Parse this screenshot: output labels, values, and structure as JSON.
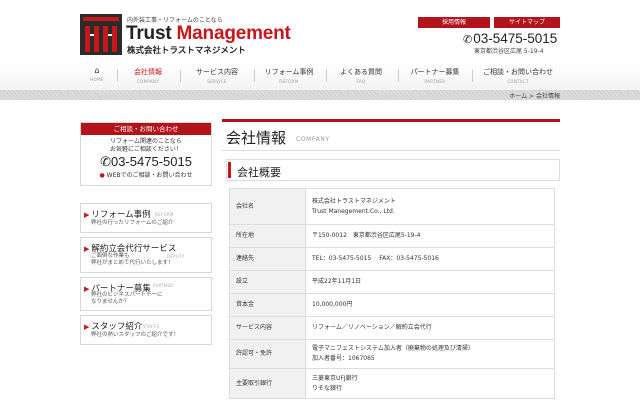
{
  "header": {
    "tagline": "内外装工事・リフォームのことなら",
    "brand_part1": "Trust",
    "brand_part2": "Management",
    "brand_jp": "株式会社トラストマネジメント",
    "top_links": [
      "採用情報",
      "サイトマップ"
    ],
    "phone": "03-5475-5015",
    "address": "東京都渋谷区広尾 5-19-4",
    "colors": {
      "accent": "#c8161d",
      "dark": "#2b2b2b"
    }
  },
  "nav": [
    {
      "label": "",
      "en": "HOME",
      "icon": "home-icon"
    },
    {
      "label": "会社情報",
      "en": "COMPANY",
      "active": true
    },
    {
      "label": "サービス内容",
      "en": "SERVICE"
    },
    {
      "label": "リフォーム事例",
      "en": "REFORM"
    },
    {
      "label": "よくある質問",
      "en": "FAQ"
    },
    {
      "label": "パートナー募集",
      "en": "PARTNER"
    },
    {
      "label": "ご相談・お問い合わせ",
      "en": "CONTACT"
    }
  ],
  "breadcrumb": {
    "home": "ホーム",
    "separator": ">",
    "current": "会社情報"
  },
  "sidebar": {
    "contact": {
      "header": "ご相談・お問い合わせ",
      "line1": "リフォーム関連のことなら",
      "line2": "お気軽にご相談ください！",
      "phone": "03-5475-5015",
      "web": "WEBでのご相談・お問い合わせ"
    },
    "items": [
      {
        "title": "リフォーム事例",
        "en": "REFORM",
        "desc": [
          "弊社の行ったリフォームのご紹介"
        ]
      },
      {
        "title": "解約立会代行サービス",
        "en": "DEPUTY",
        "desc": [
          "ご面倒な作業も",
          "弊社がまとめて代行いたします！"
        ]
      },
      {
        "title": "パートナー募集",
        "en": "PARTNER",
        "desc": [
          "弊社のビジネスパートナーに",
          "なりませんか？"
        ]
      },
      {
        "title": "スタッフ紹介",
        "en": "STAFFS",
        "desc": [
          "弊社の熱いスタッフのご紹介です！"
        ]
      }
    ]
  },
  "main": {
    "title": "会社情報",
    "title_en": "COMPANY",
    "section": "会社概要",
    "rows": [
      {
        "label": "会社名",
        "value": [
          "株式会社トラストマネジメント",
          "Trust Manegement.Co., Ltd."
        ]
      },
      {
        "label": "所在地",
        "value": [
          "〒150-0012　東京都渋谷区広尾5-19-4"
        ]
      },
      {
        "label": "連絡先",
        "value": [
          "TEL：03-5475-5015　 FAX：03-5475-5016"
        ]
      },
      {
        "label": "設立",
        "value": [
          "平成22年11月1日"
        ]
      },
      {
        "label": "資本金",
        "value": [
          "10,000,000円"
        ]
      },
      {
        "label": "サービス内容",
        "value": [
          "リフォーム／リノベーション／解約立会代行"
        ]
      },
      {
        "label": "許認可・免許",
        "value": [
          "電子マニフェストシステム加入者（廃棄物の処理及び清掃）",
          "加入者番号：1067065"
        ]
      },
      {
        "label": "主要取引銀行",
        "value": [
          "三菱東京UFJ銀行",
          "りそな銀行"
        ]
      }
    ]
  }
}
